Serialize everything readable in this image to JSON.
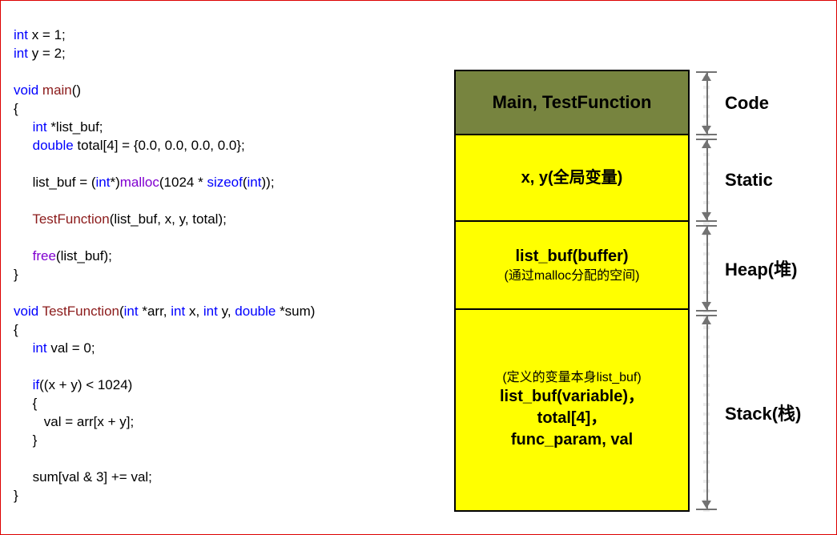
{
  "code": {
    "l01_kw1": "int",
    "l01_rest": " x = 1;",
    "l02_kw1": "int",
    "l02_rest": " y = 2;",
    "l04_kw1": "void",
    "l04_fn": " main",
    "l04_rest": "()",
    "l05_brace": "{",
    "l06_kw1": "int",
    "l06_rest": " *list_buf;",
    "l07_kw1": "double",
    "l07_rest": " total[4] = {0.0, 0.0, 0.0, 0.0};",
    "l09_a": "     list_buf = (",
    "l09_kw": "int",
    "l09_b": "*)",
    "l09_lib": "malloc",
    "l09_c": "(1024 * ",
    "l09_kw2": "sizeof",
    "l09_d": "(",
    "l09_kw3": "int",
    "l09_e": "));",
    "l11_fn": "TestFunction",
    "l11_rest": "(list_buf, x, y, total);",
    "l13_lib": "free",
    "l13_rest": "(list_buf);",
    "l14_brace": "}",
    "l16_kw1": "void",
    "l16_fn": " TestFunction",
    "l16_a": "(",
    "l16_kw2": "int",
    "l16_b": " *arr, ",
    "l16_kw3": "int",
    "l16_c": " x, ",
    "l16_kw4": "int",
    "l16_d": " y, ",
    "l16_kw5": "double",
    "l16_e": " *sum)",
    "l17_brace": "{",
    "l18_kw1": "int",
    "l18_rest": " val = 0;",
    "l20_kw1": "if",
    "l20_rest": "((x + y) < 1024)",
    "l21_brace": "     {",
    "l22_rest": "        val = arr[x + y];",
    "l23_brace": "     }",
    "l25_rest": "     sum[val & 3] += val;",
    "l26_brace": "}"
  },
  "memory": {
    "code_title": "Main, TestFunction",
    "static_title": "x, y(全局变量)",
    "heap_title": "list_buf(buffer)",
    "heap_sub": "(通过malloc分配的空间)",
    "stack_sub": "(定义的变量本身list_buf)",
    "stack_l1": "list_buf(variable)，",
    "stack_l2": "total[4]，",
    "stack_l3": "func_param, val"
  },
  "labels": {
    "code": "Code",
    "static": "Static",
    "heap": "Heap(堆)",
    "stack": "Stack(栈)"
  }
}
